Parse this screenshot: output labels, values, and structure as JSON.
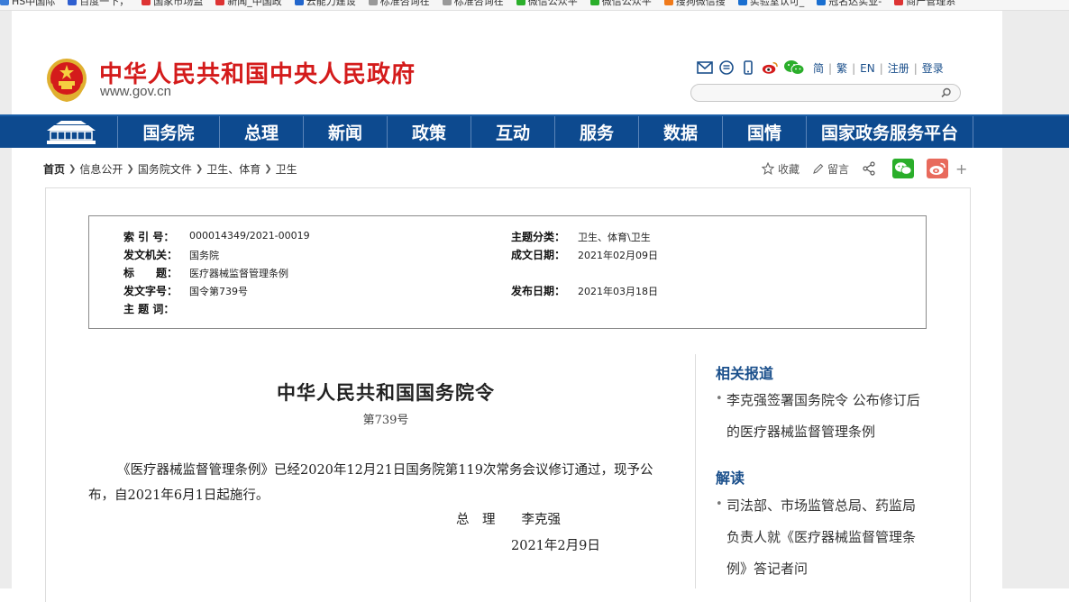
{
  "bookmarks": [
    {
      "label": "HS中国际",
      "color": "#3b7dd8"
    },
    {
      "label": "百度一下，",
      "color": "#2f5fd0"
    },
    {
      "label": "国家市场监",
      "color": "#d33"
    },
    {
      "label": "新闻_中国政",
      "color": "#d33"
    },
    {
      "label": "云能力建设",
      "color": "#2266cc"
    },
    {
      "label": "标准咨询在",
      "color": "#999"
    },
    {
      "label": "标准咨询在",
      "color": "#999"
    },
    {
      "label": "微信公众平",
      "color": "#2aae2a"
    },
    {
      "label": "微信公众平",
      "color": "#2aae2a"
    },
    {
      "label": "搜狗微信搜",
      "color": "#f07a1a"
    },
    {
      "label": "实验室认可_",
      "color": "#1a6fd0"
    },
    {
      "label": "冠名达实业-",
      "color": "#1a6fd0"
    },
    {
      "label": "商产管理系",
      "color": "#d33"
    }
  ],
  "site": {
    "title": "中华人民共和国中央人民政府",
    "url": "www.gov.cn"
  },
  "header": {
    "links": [
      "简",
      "繁",
      "EN",
      "注册",
      "登录"
    ],
    "search_placeholder": ""
  },
  "nav": {
    "items": [
      {
        "label": "国务院",
        "width": 113
      },
      {
        "label": "总理",
        "width": 93
      },
      {
        "label": "新闻",
        "width": 93
      },
      {
        "label": "政策",
        "width": 93
      },
      {
        "label": "互动",
        "width": 93
      },
      {
        "label": "服务",
        "width": 93
      },
      {
        "label": "数据",
        "width": 93
      },
      {
        "label": "国情",
        "width": 93
      },
      {
        "label": "国家政务服务平台",
        "width": 186
      }
    ]
  },
  "breadcrumb": [
    "首页",
    "信息公开",
    "国务院文件",
    "卫生、体育",
    "卫生"
  ],
  "tools": {
    "favorite": "收藏",
    "comment": "留言",
    "plus": "+"
  },
  "info": {
    "index_label": "索 引 号：",
    "index_value": "000014349/2021-00019",
    "category_label": "主题分类：",
    "category_value": "卫生、体育\\卫生",
    "issuer_label": "发文机关：",
    "issuer_value": "国务院",
    "created_label": "成文日期：",
    "created_value": "2021年02月09日",
    "title_label": "标　　题：",
    "title_value": "医疗器械监督管理条例",
    "docno_label": "发文字号：",
    "docno_value": "国令第739号",
    "published_label": "发布日期：",
    "published_value": "2021年03月18日",
    "keywords_label": "主 题 词：",
    "keywords_value": ""
  },
  "document": {
    "title": "中华人民共和国国务院令",
    "number": "第739号",
    "body": "《医疗器械监督管理条例》已经2020年12月21日国务院第119次常务会议修订通过，现予公布，自2021年6月1日起施行。",
    "signature": "总　理　　李克强",
    "date": "2021年2月9日"
  },
  "sidebar": {
    "related_heading": "相关报道",
    "related_links": [
      "李克强签署国务院令 公布修订后的医疗器械监督管理条例"
    ],
    "interpret_heading": "解读",
    "interpret_links": [
      "司法部、市场监管总局、药监局负责人就《医疗器械监督管理条例》答记者问"
    ]
  }
}
